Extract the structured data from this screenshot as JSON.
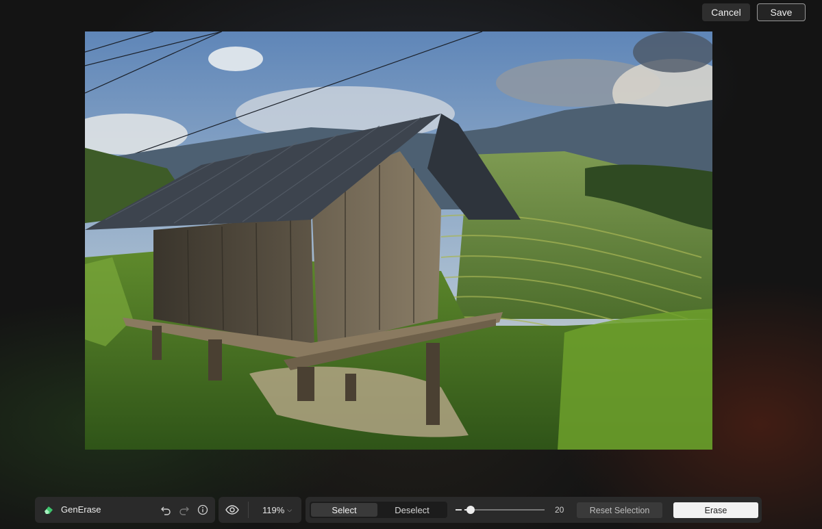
{
  "header": {
    "cancel_label": "Cancel",
    "save_label": "Save"
  },
  "tool": {
    "name": "GenErase",
    "icon": "eraser-icon"
  },
  "view": {
    "zoom_label": "119%"
  },
  "brush": {
    "select_label": "Select",
    "deselect_label": "Deselect",
    "active_mode": "Select",
    "size_value": "20",
    "size_fraction": 0.08,
    "reset_label": "Reset Selection",
    "erase_label": "Erase"
  },
  "colors": {
    "accent_green": "#3ec46d",
    "toolbar_bg": "#2a2a2a",
    "erase_bg": "#f2f2f2"
  },
  "icons": [
    "eraser-icon",
    "undo-icon",
    "redo-icon",
    "info-icon",
    "eye-icon",
    "chevron-down-icon"
  ]
}
